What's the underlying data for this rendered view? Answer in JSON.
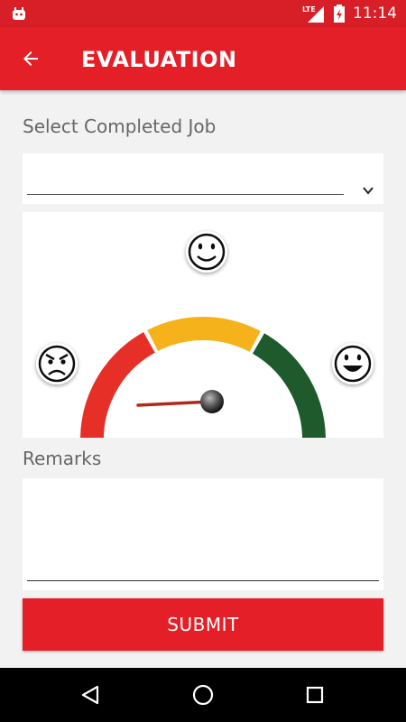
{
  "status_bar": {
    "time": "11:14",
    "network_label": "LTE",
    "icons": [
      "android-icon",
      "signal-icon",
      "battery-icon"
    ]
  },
  "header": {
    "title": "EVALUATION",
    "back_icon": "arrow-left-icon",
    "color": "#e41f27"
  },
  "job": {
    "label": "Select Completed Job",
    "selected_value": "",
    "dropdown_icon": "chevron-down-icon"
  },
  "gauge": {
    "level": 0.0,
    "segments": [
      {
        "name": "bad",
        "color": "#e63027"
      },
      {
        "name": "neutral",
        "color": "#f6b21b"
      },
      {
        "name": "good",
        "color": "#1e5a2c"
      }
    ],
    "faces": [
      "angry-face-icon",
      "smile-face-icon",
      "happy-face-icon"
    ]
  },
  "remarks": {
    "label": "Remarks",
    "value": ""
  },
  "submit": {
    "label": "SUBMIT"
  },
  "nav": {
    "icons": [
      "back-triangle-icon",
      "home-circle-icon",
      "recents-square-icon"
    ]
  }
}
